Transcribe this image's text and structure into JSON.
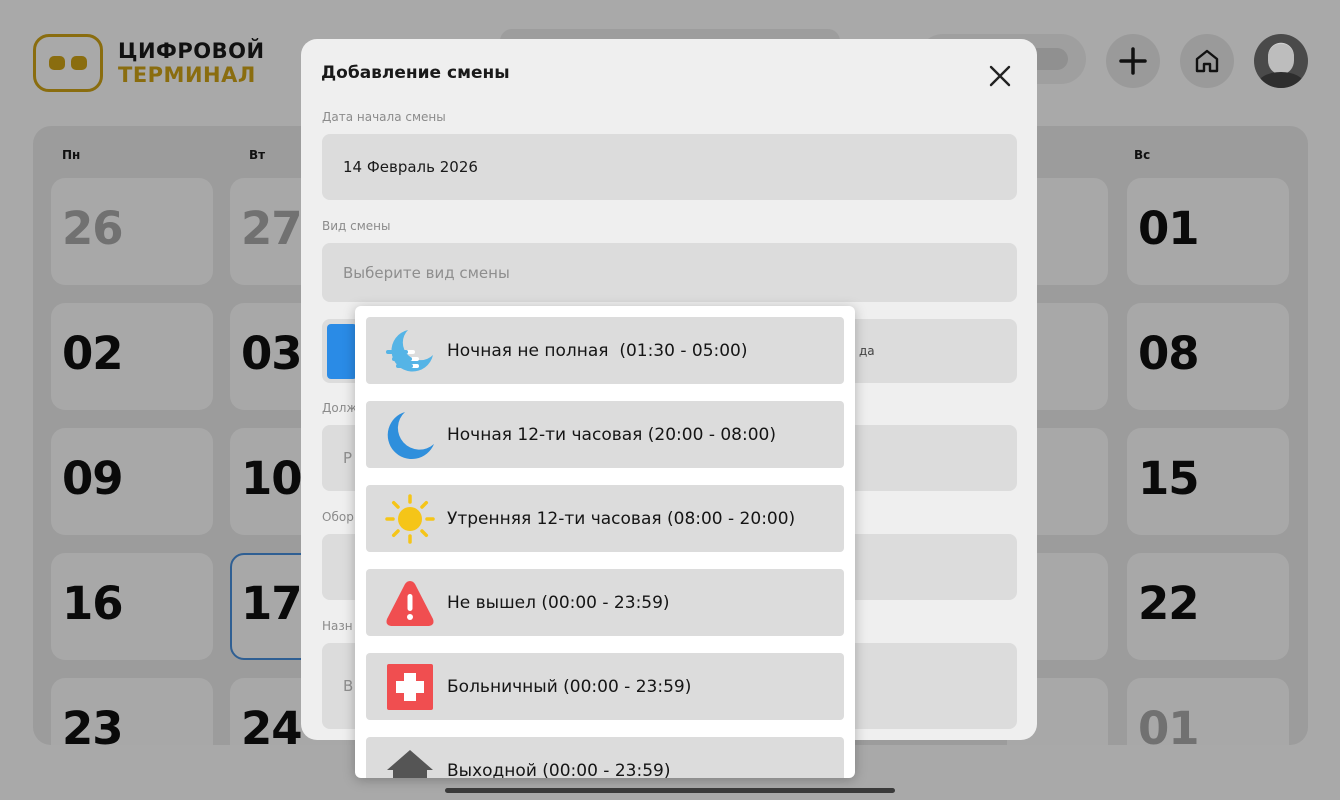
{
  "header": {
    "logo_line1": "ЦИФРОВОЙ",
    "logo_line2": "ТЕРМИНАЛ",
    "add_icon": "plus-icon",
    "home_icon": "home-icon"
  },
  "calendar": {
    "weekdays": {
      "mon": "Пн",
      "tue": "Вт",
      "sun": "Вс"
    },
    "days": {
      "mon": [
        "26",
        "02",
        "09",
        "16",
        "23"
      ],
      "tue": [
        "27",
        "03",
        "10",
        "17",
        "24"
      ],
      "sun": [
        "01",
        "08",
        "15",
        "22",
        "01"
      ]
    },
    "selected_day": "17"
  },
  "modal": {
    "title": "Добавление смены",
    "close_icon": "close-icon",
    "start_date_label": "Дата начала смены",
    "start_date_value": "14 Февраль 2026",
    "shift_type_label": "Вид смены",
    "shift_type_placeholder": "Выберите вид смены",
    "partial_row_tail": "да",
    "partial_label_position": "Долж",
    "partial_value_position": "Р",
    "partial_label_equipment": "Обор",
    "partial_label_assign": "Назн",
    "partial_value_assign": "В"
  },
  "dropdown": {
    "options": [
      {
        "label": "Ночная не полная  (01:30 - 05:00)",
        "icon": "moon-fog-icon"
      },
      {
        "label": "Ночная 12-ти часовая (20:00 - 08:00)",
        "icon": "crescent-moon-icon"
      },
      {
        "label": "Утренняя 12-ти часовая (08:00 - 20:00)",
        "icon": "sun-icon"
      },
      {
        "label": "Не вышел (00:00 - 23:59)",
        "icon": "warning-icon"
      },
      {
        "label": "Больничный (00:00 - 23:59)",
        "icon": "medical-cross-icon"
      },
      {
        "label": "Выходной (00:00 - 23:59)",
        "icon": "house-roof-icon"
      }
    ]
  },
  "colors": {
    "accent_blue": "#2a8be6",
    "moon_light": "#55b4e6",
    "moon_dark": "#2f8fdc",
    "sun": "#f5c518",
    "warning_red": "#f04e50",
    "logo_gold": "#8a6d0f"
  }
}
